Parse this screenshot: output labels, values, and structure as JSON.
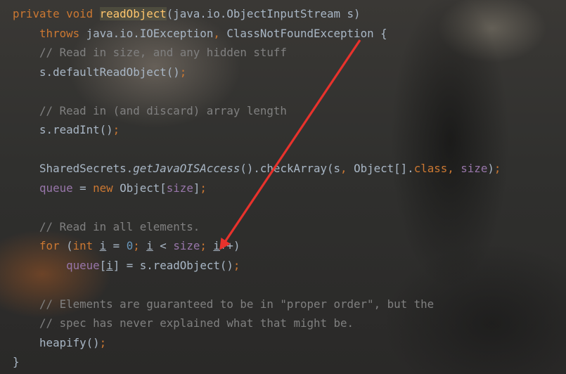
{
  "code": {
    "lines": [
      [
        {
          "t": "private void ",
          "c": "kw"
        },
        {
          "t": "readObject",
          "c": "fn hl"
        },
        {
          "t": "(java.io.ObjectInputStream s)",
          "c": ""
        }
      ],
      [
        {
          "t": "    throws ",
          "c": "kw"
        },
        {
          "t": "java.io.IOException",
          "c": ""
        },
        {
          "t": ", ",
          "c": "kw"
        },
        {
          "t": "ClassNotFoundException {",
          "c": ""
        }
      ],
      [
        {
          "t": "    // Read in size, and any hidden stuff",
          "c": "cm"
        }
      ],
      [
        {
          "t": "    s.defaultReadObject()",
          "c": ""
        },
        {
          "t": ";",
          "c": "kw"
        }
      ],
      [],
      [
        {
          "t": "    // Read in (and discard) array length",
          "c": "cm"
        }
      ],
      [
        {
          "t": "    s.readInt()",
          "c": ""
        },
        {
          "t": ";",
          "c": "kw"
        }
      ],
      [],
      [
        {
          "t": "    SharedSecrets.",
          "c": ""
        },
        {
          "t": "getJavaOISAccess",
          "c": "it"
        },
        {
          "t": "().checkArray(s",
          "c": ""
        },
        {
          "t": ", ",
          "c": "kw"
        },
        {
          "t": "Object[].",
          "c": ""
        },
        {
          "t": "class",
          "c": "kw"
        },
        {
          "t": ", ",
          "c": "kw"
        },
        {
          "t": "size",
          "c": "fld"
        },
        {
          "t": ")",
          "c": ""
        },
        {
          "t": ";",
          "c": "kw"
        }
      ],
      [
        {
          "t": "    ",
          "c": ""
        },
        {
          "t": "queue",
          "c": "fld"
        },
        {
          "t": " = ",
          "c": ""
        },
        {
          "t": "new ",
          "c": "kw"
        },
        {
          "t": "Object[",
          "c": ""
        },
        {
          "t": "size",
          "c": "fld"
        },
        {
          "t": "]",
          "c": ""
        },
        {
          "t": ";",
          "c": "kw"
        }
      ],
      [],
      [
        {
          "t": "    // Read in all elements.",
          "c": "cm"
        }
      ],
      [
        {
          "t": "    for ",
          "c": "kw"
        },
        {
          "t": "(",
          "c": ""
        },
        {
          "t": "int ",
          "c": "kw"
        },
        {
          "t": "i",
          "c": "var"
        },
        {
          "t": " = ",
          "c": ""
        },
        {
          "t": "0",
          "c": "num"
        },
        {
          "t": "; ",
          "c": "kw"
        },
        {
          "t": "i",
          "c": "var"
        },
        {
          "t": " < ",
          "c": ""
        },
        {
          "t": "size",
          "c": "fld"
        },
        {
          "t": "; ",
          "c": "kw"
        },
        {
          "t": "i",
          "c": "var"
        },
        {
          "t": "++)",
          "c": ""
        }
      ],
      [
        {
          "t": "        ",
          "c": ""
        },
        {
          "t": "queue",
          "c": "fld"
        },
        {
          "t": "[",
          "c": ""
        },
        {
          "t": "i",
          "c": "var"
        },
        {
          "t": "] = s.readObject()",
          "c": ""
        },
        {
          "t": ";",
          "c": "kw"
        }
      ],
      [],
      [
        {
          "t": "    // Elements are guaranteed to be in \"proper order\", but the",
          "c": "cm"
        }
      ],
      [
        {
          "t": "    // spec has never explained what that might be.",
          "c": "cm"
        }
      ],
      [
        {
          "t": "    heapify()",
          "c": ""
        },
        {
          "t": ";",
          "c": "kw"
        }
      ],
      [
        {
          "t": "}",
          "c": ""
        }
      ]
    ]
  },
  "annotation": {
    "icon": "red-arrow-icon",
    "color": "#e8322c"
  }
}
